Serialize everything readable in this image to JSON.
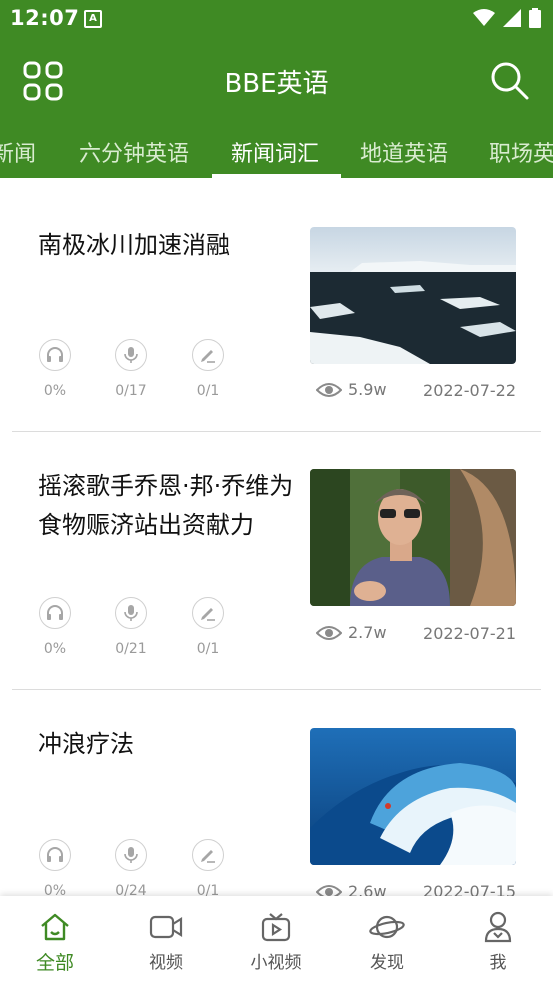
{
  "status_bar": {
    "time": "12:07",
    "notification_glyph": "A"
  },
  "app_bar": {
    "title": "BBE英语"
  },
  "tabs": [
    {
      "label": "新闻"
    },
    {
      "label": "六分钟英语"
    },
    {
      "label": "新闻词汇",
      "active": true
    },
    {
      "label": "地道英语"
    },
    {
      "label": "职场英"
    }
  ],
  "articles": [
    {
      "title": "南极冰川加速消融",
      "listen": "0%",
      "speak": "0/17",
      "write": "0/1",
      "views": "5.9w",
      "date": "2022-07-22",
      "image": "antarctic-glacier-photo"
    },
    {
      "title": "摇滚歌手乔恩·邦·乔维为食物赈济站出资献力",
      "listen": "0%",
      "speak": "0/21",
      "write": "0/1",
      "views": "2.7w",
      "date": "2022-07-21",
      "image": "man-in-sunglasses-photo"
    },
    {
      "title": "冲浪疗法",
      "listen": "0%",
      "speak": "0/24",
      "write": "0/1",
      "views": "2.6w",
      "date": "2022-07-15",
      "image": "surfer-wave-photo"
    }
  ],
  "bottom_nav": [
    {
      "label": "全部",
      "icon": "home-icon",
      "active": true
    },
    {
      "label": "视频",
      "icon": "video-camera-icon"
    },
    {
      "label": "小视频",
      "icon": "tv-play-icon"
    },
    {
      "label": "发现",
      "icon": "planet-icon"
    },
    {
      "label": "我",
      "icon": "user-icon"
    }
  ],
  "colors": {
    "brand_green": "#3f8a24"
  }
}
